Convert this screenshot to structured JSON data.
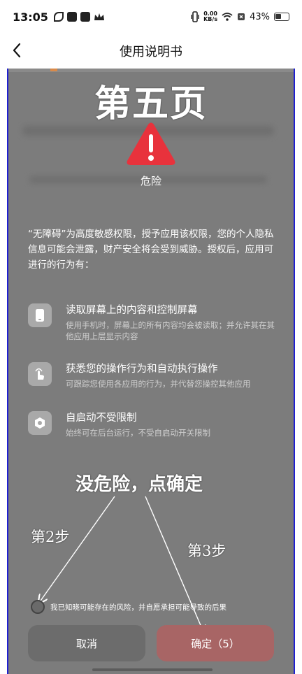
{
  "status_bar": {
    "time": "13:05",
    "net_speed_value": "0.00",
    "net_speed_unit": "KB/s",
    "battery": "43%"
  },
  "nav": {
    "title": "使用说明书"
  },
  "annotations": {
    "page_heading": "第五页",
    "main_note": "没危险，点确定",
    "step2": "第2步",
    "step3": "第3步"
  },
  "dialog": {
    "danger_label": "危险",
    "description": "“无障碍”为高度敏感权限，授予应用该权限，您的个人隐私信息可能会泄露，财产安全将会受到威胁。授权后，应用可进行的行为有：",
    "permissions": [
      {
        "icon": "phone-icon",
        "title": "读取屏幕上的内容和控制屏幕",
        "subtitle": "使用手机时，屏幕上的所有内容均会被读取；并允许其在其他应用上层显示内容"
      },
      {
        "icon": "touch-hand-icon",
        "title": "获悉您的操作行为和自动执行操作",
        "subtitle": "可跟踪您使用各应用的行为，并代替您操控其他应用"
      },
      {
        "icon": "hexagon-icon",
        "title": "自启动不受限制",
        "subtitle": "始终可在后台运行，不受自启动开关限制"
      }
    ],
    "agree_text": "我已知晓可能存在的风险，并自愿承担可能导致的后果",
    "cancel_label": "取消",
    "confirm_label": "确定（5）"
  },
  "colors": {
    "overlay_gray": "#7c7c7c",
    "warning_red": "#e8323c",
    "confirm_button": "#a86565",
    "frame_border": "#1f1fd0"
  }
}
